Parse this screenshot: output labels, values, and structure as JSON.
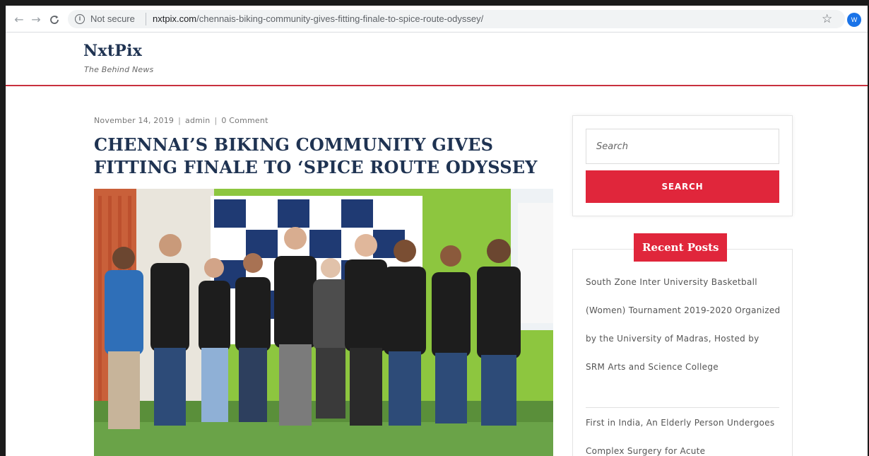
{
  "browser": {
    "back_icon": "←",
    "forward_icon": "→",
    "reload_icon": "C",
    "info_icon": "i",
    "security_label": "Not secure",
    "url_domain": "nxtpix.com",
    "url_path": "/chennais-biking-community-gives-fitting-finale-to-spice-route-odyssey/",
    "star_icon": "☆",
    "profile_initial": "W",
    "profile_color": "#1a73e8"
  },
  "site": {
    "title": "NxtPix",
    "tagline": "The Behind News",
    "accent_color": "#e0263b",
    "header_color": "#1f3352"
  },
  "post": {
    "date": "November 14, 2019",
    "author": "admin",
    "comments": "0 Comment",
    "meta_sep": "|",
    "title": "CHENNAI’S BIKING COMMUNITY GIVES FITTING FINALE TO ‘SPICE ROUTE ODYSSEY"
  },
  "sidebar": {
    "search_placeholder": "Search",
    "search_button": "SEARCH",
    "recent_title": "Recent Posts",
    "recent_posts": [
      "South Zone Inter University Basketball (Women) Tournament 2019-2020 Organized by the University of Madras, Hosted by SRM Arts and Science College",
      "First in India, An Elderly Person Undergoes Complex Surgery for Acute"
    ]
  }
}
